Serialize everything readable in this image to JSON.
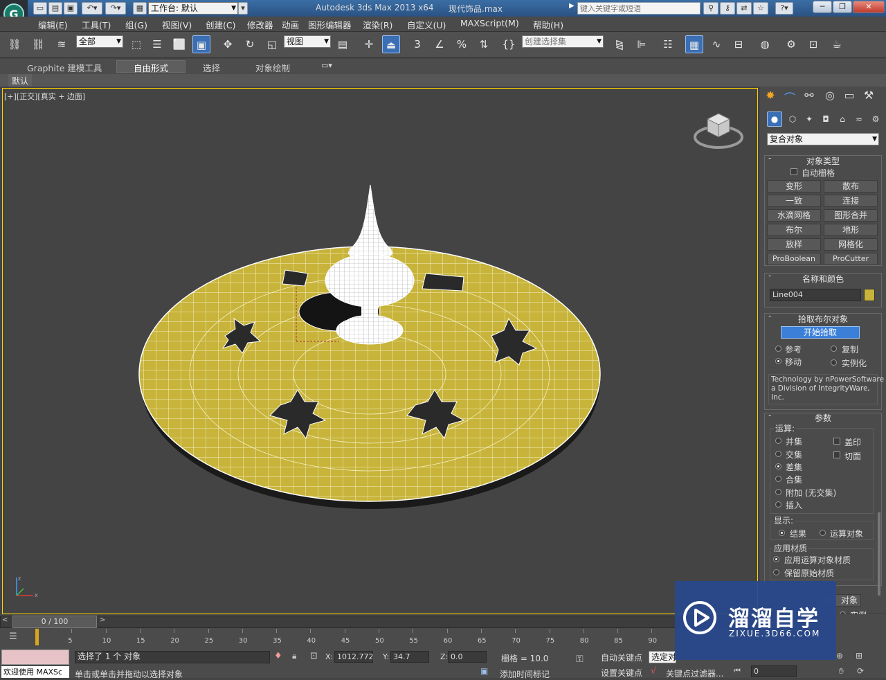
{
  "titlebar": {
    "workspace": "工作台: 默认",
    "app_title": "Autodesk 3ds Max  2013 x64",
    "file_name": "现代饰品.max",
    "search_placeholder": "键入关键字或短语"
  },
  "menu": [
    "编辑(E)",
    "工具(T)",
    "组(G)",
    "视图(V)",
    "创建(C)",
    "修改器",
    "动画",
    "图形编辑器",
    "渲染(R)",
    "自定义(U)",
    "MAXScript(M)",
    "帮助(H)"
  ],
  "toolbar": {
    "filter_value": "全部",
    "ref_coord_value": "视图",
    "selection_set_placeholder": "创建选择集",
    "snap_value": "3"
  },
  "ribbon": {
    "tabs": [
      "Graphite 建模工具",
      "自由形式",
      "选择",
      "对象绘制"
    ],
    "active_tab": "自由形式",
    "sub_label": "默认"
  },
  "viewport": {
    "label_parts": [
      "[+]",
      "[正交]",
      "[真实 + 边面]"
    ],
    "object_color": "#c8b43a"
  },
  "panel": {
    "category_value": "复合对象",
    "object_type": {
      "title": "对象类型",
      "autogrid": "自动栅格",
      "buttons": [
        "变形",
        "散布",
        "一致",
        "连接",
        "水滴网格",
        "图形合并",
        "布尔",
        "地形",
        "放样",
        "网格化",
        "ProBoolean",
        "ProCutter"
      ]
    },
    "name_color": {
      "title": "名称和颜色",
      "name": "Line004",
      "swatch": "#c8b43a"
    },
    "pick_boolean": {
      "title": "拾取布尔对象",
      "pick_button": "开始拾取",
      "options": [
        "参考",
        "复制",
        "移动",
        "实例化"
      ],
      "selected": "移动",
      "credit": [
        "Technology by nPowerSoftware",
        "a Division of IntegrityWare,",
        "Inc."
      ]
    },
    "params": {
      "title": "参数",
      "operation_label": "运算:",
      "operations": [
        "并集",
        "交集",
        "差集",
        "合集",
        "附加 (无交集)",
        "插入"
      ],
      "selected_operation": "差集",
      "checkboxes": [
        "盖印",
        "切面"
      ],
      "display_label": "显示:",
      "display_options": [
        "结果",
        "运算对象"
      ],
      "display_selected": "结果",
      "material_label": "应用材质",
      "material_options": [
        "应用运算对象材质",
        "保留原始材质"
      ],
      "material_selected": "应用运算对象材质",
      "partial_button": "对象",
      "partial_instance": "实例",
      "partial_spinner": "0"
    }
  },
  "timeline": {
    "frame": "0 / 100",
    "ticks": [
      "5",
      "10",
      "15",
      "20",
      "25",
      "30",
      "35",
      "40",
      "45",
      "50",
      "55",
      "60",
      "65",
      "70",
      "75",
      "80",
      "85",
      "90"
    ]
  },
  "status": {
    "selected": "选择了 1 个 对象",
    "prompt": "单击或单击并拖动以选择对象",
    "welcome": "欢迎使用 MAXSc",
    "x_label": "X:",
    "x": "1012.772",
    "y_label": "Y:",
    "y": "34.7",
    "z_label": "Z:",
    "z": "0.0",
    "grid": "栅格 = 10.0",
    "auto_key": "自动关键点",
    "set_key": "设置关键点",
    "select_dropdown": "选定对",
    "key_filter": "关键点过滤器...",
    "add_time_tag": "添加时间标记",
    "frame_field": "0"
  },
  "watermark": {
    "name": "溜溜自学",
    "url": "ZIXUE.3D66.COM"
  }
}
